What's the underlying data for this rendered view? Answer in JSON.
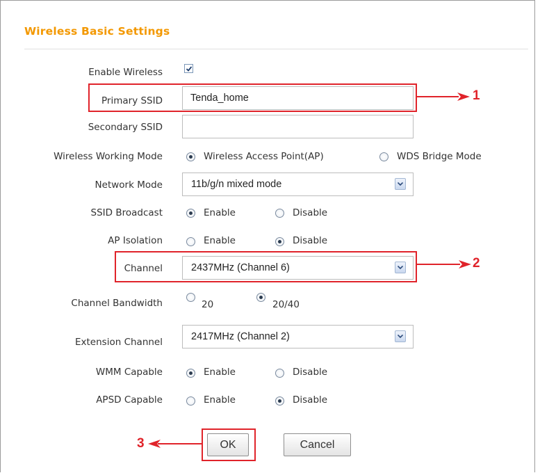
{
  "title": "Wireless Basic Settings",
  "fields": {
    "enable_wireless": {
      "label": "Enable Wireless",
      "checked": true
    },
    "primary_ssid": {
      "label": "Primary SSID",
      "value": "Tenda_home"
    },
    "secondary_ssid": {
      "label": "Secondary SSID",
      "value": ""
    },
    "working_mode": {
      "label": "Wireless Working Mode",
      "opt1": "Wireless Access Point(AP)",
      "opt2": "WDS Bridge Mode",
      "selected": "opt1"
    },
    "network_mode": {
      "label": "Network Mode",
      "value": "11b/g/n mixed mode"
    },
    "ssid_broadcast": {
      "label": "SSID Broadcast",
      "opt1": "Enable",
      "opt2": "Disable",
      "selected": "opt1"
    },
    "ap_isolation": {
      "label": "AP Isolation",
      "opt1": "Enable",
      "opt2": "Disable",
      "selected": "opt2"
    },
    "channel": {
      "label": "Channel",
      "value": "2437MHz (Channel 6)"
    },
    "channel_bandwidth": {
      "label": "Channel Bandwidth",
      "opt1": "20",
      "opt2": "20/40",
      "selected": "opt2"
    },
    "extension_channel": {
      "label": "Extension Channel",
      "value": "2417MHz (Channel 2)"
    },
    "wmm": {
      "label": "WMM Capable",
      "opt1": "Enable",
      "opt2": "Disable",
      "selected": "opt1"
    },
    "apsd": {
      "label": "APSD Capable",
      "opt1": "Enable",
      "opt2": "Disable",
      "selected": "opt2"
    }
  },
  "buttons": {
    "ok": "OK",
    "cancel": "Cancel"
  },
  "callouts": {
    "one": "1",
    "two": "2",
    "three": "3"
  },
  "colors": {
    "title": "#f39800",
    "highlight": "#e0232a"
  },
  "icons": {
    "check": "checkmark-icon",
    "dropdown": "chevron-down-icon"
  }
}
